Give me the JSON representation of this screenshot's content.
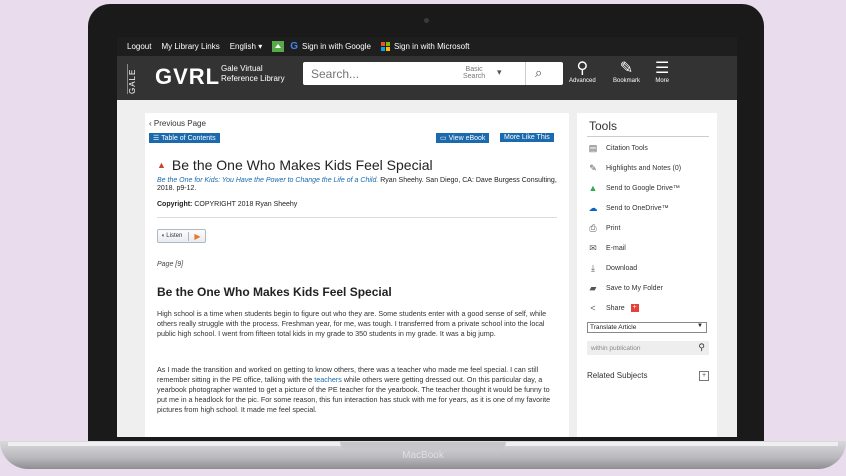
{
  "device": {
    "brand": "MacBook"
  },
  "topbar": {
    "logout": "Logout",
    "my_library_links": "My Library Links",
    "language": "English",
    "google_signin": "Sign in with Google",
    "microsoft_signin": "Sign in with Microsoft"
  },
  "header": {
    "gale": "GALE",
    "gvrl": "GVRL",
    "sub_line1": "Gale Virtual",
    "sub_line2": "Reference Library",
    "search_placeholder": "Search...",
    "basic_search_line1": "Basic",
    "basic_search_line2": "Search",
    "advanced": "Advanced",
    "bookmark": "Bookmark",
    "more": "More"
  },
  "content": {
    "previous_page": "Previous Page",
    "table_of_contents": "Table of Contents",
    "view_ebook": "View eBook",
    "more_like_this": "More Like This",
    "title": "Be the One Who Makes Kids Feel Special",
    "citation_link": "Be the One for Kids: You Have the Power to Change the Life of a Child.",
    "citation_rest": " Ryan Sheehy. San Diego, CA: Dave Burgess Consulting, 2018. p9-12.",
    "copyright_label": "Copyright:",
    "copyright_text": " COPYRIGHT 2018 Ryan Sheehy",
    "listen": "Listen",
    "page_number": "Page [9]",
    "heading": "Be the One Who Makes Kids Feel Special",
    "para1": "High school is a time when students begin to figure out who they are. Some students enter with a good sense of self, while others really struggle with the process. Freshman year, for me, was tough. I transferred from a private school into the local public high school. I went from fifteen total kids in my grade to 350 students in my grade. It was a big jump.",
    "para2_a": "As I made the transition and worked on getting to know others, there was a teacher who made me feel special. I can still remember sitting in the PE office, talking with the ",
    "para2_link": "teachers",
    "para2_b": " while others were getting dressed out. On this particular day, a yearbook photographer wanted to get a picture of the PE teacher for the yearbook. The teacher thought it would be funny to put me in a headlock for the pic. For some reason, this fun interaction has stuck with me for years, as it is one of my favorite pictures from high school. It made me feel special."
  },
  "tools": {
    "title": "Tools",
    "items": [
      {
        "label": "Citation Tools",
        "icon": "citation-icon"
      },
      {
        "label": "Highlights and Notes (0)",
        "icon": "highlighter-icon"
      },
      {
        "label": "Send to Google Drive™",
        "icon": "google-drive-icon"
      },
      {
        "label": "Send to OneDrive™",
        "icon": "onedrive-icon"
      },
      {
        "label": "Print",
        "icon": "print-icon"
      },
      {
        "label": "E-mail",
        "icon": "email-icon"
      },
      {
        "label": "Download",
        "icon": "download-icon"
      },
      {
        "label": "Save to My Folder",
        "icon": "folder-icon"
      },
      {
        "label": "Share",
        "icon": "share-icon"
      }
    ],
    "translate": "Translate Article",
    "within_publication": "within publication",
    "related_subjects": "Related Subjects"
  },
  "colors": {
    "accent": "#1a6aad",
    "header": "#333333",
    "title_triangle": "#c8452a"
  }
}
